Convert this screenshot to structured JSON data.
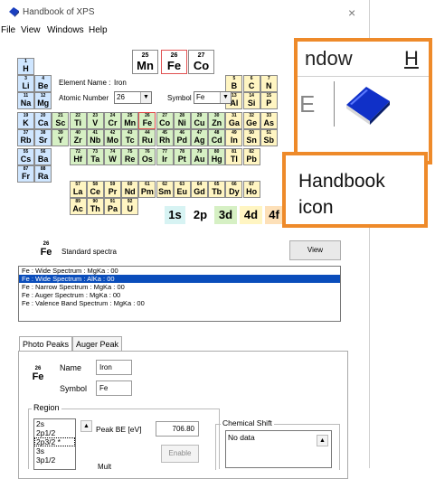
{
  "window": {
    "title": "Handbook of XPS",
    "close_glyph": "×"
  },
  "menu": [
    "File",
    "View",
    "Windows",
    "Help"
  ],
  "element_info": {
    "name_label": "Element Name :",
    "name_value": "Iron",
    "atomic_label": "Atomic Number",
    "atomic_value": "26",
    "symbol_label": "Symbol",
    "symbol_value": "Fe"
  },
  "header_elements": [
    {
      "n": "25",
      "s": "Mn"
    },
    {
      "n": "26",
      "s": "Fe"
    },
    {
      "n": "27",
      "s": "Co"
    }
  ],
  "periodic": {
    "h": {
      "n": "1",
      "s": "H"
    },
    "row2": [
      {
        "n": "3",
        "s": "Li"
      },
      {
        "n": "4",
        "s": "Be"
      }
    ],
    "row2r": [
      {
        "n": "5",
        "s": "B"
      },
      {
        "n": "6",
        "s": "C"
      },
      {
        "n": "7",
        "s": "N"
      }
    ],
    "row3": [
      {
        "n": "11",
        "s": "Na"
      },
      {
        "n": "12",
        "s": "Mg"
      }
    ],
    "row3r": [
      {
        "n": "13",
        "s": "Al"
      },
      {
        "n": "14",
        "s": "Si"
      },
      {
        "n": "15",
        "s": "P"
      }
    ],
    "row4": [
      {
        "n": "19",
        "s": "K"
      },
      {
        "n": "20",
        "s": "Ca"
      },
      {
        "n": "21",
        "s": "Sc"
      },
      {
        "n": "22",
        "s": "Ti"
      },
      {
        "n": "23",
        "s": "V"
      },
      {
        "n": "24",
        "s": "Cr"
      },
      {
        "n": "25",
        "s": "Mn"
      },
      {
        "n": "26",
        "s": "Fe"
      },
      {
        "n": "27",
        "s": "Co"
      },
      {
        "n": "28",
        "s": "Ni"
      },
      {
        "n": "29",
        "s": "Cu"
      },
      {
        "n": "30",
        "s": "Zn"
      },
      {
        "n": "31",
        "s": "Ga"
      },
      {
        "n": "32",
        "s": "Ge"
      },
      {
        "n": "33",
        "s": "As"
      }
    ],
    "row5": [
      {
        "n": "37",
        "s": "Rb"
      },
      {
        "n": "38",
        "s": "Sr"
      },
      {
        "n": "39",
        "s": "Y"
      },
      {
        "n": "40",
        "s": "Zr"
      },
      {
        "n": "41",
        "s": "Nb"
      },
      {
        "n": "42",
        "s": "Mo"
      },
      {
        "n": "43",
        "s": "Tc"
      },
      {
        "n": "44",
        "s": "Ru"
      },
      {
        "n": "45",
        "s": "Rh"
      },
      {
        "n": "46",
        "s": "Pd"
      },
      {
        "n": "47",
        "s": "Ag"
      },
      {
        "n": "48",
        "s": "Cd"
      },
      {
        "n": "49",
        "s": "In"
      },
      {
        "n": "50",
        "s": "Sn"
      },
      {
        "n": "51",
        "s": "Sb"
      }
    ],
    "row6": [
      {
        "n": "55",
        "s": "Cs"
      },
      {
        "n": "56",
        "s": "Ba"
      },
      {
        "n": "",
        "s": ""
      },
      {
        "n": "72",
        "s": "Hf"
      },
      {
        "n": "73",
        "s": "Ta"
      },
      {
        "n": "74",
        "s": "W"
      },
      {
        "n": "75",
        "s": "Re"
      },
      {
        "n": "76",
        "s": "Os"
      },
      {
        "n": "77",
        "s": "Ir"
      },
      {
        "n": "78",
        "s": "Pt"
      },
      {
        "n": "79",
        "s": "Au"
      },
      {
        "n": "80",
        "s": "Hg"
      },
      {
        "n": "81",
        "s": "Tl"
      },
      {
        "n": "82",
        "s": "Pb"
      }
    ],
    "row7": [
      {
        "n": "87",
        "s": "Fr"
      },
      {
        "n": "88",
        "s": "Ra"
      }
    ],
    "lanth": [
      {
        "n": "57",
        "s": "La"
      },
      {
        "n": "58",
        "s": "Ce"
      },
      {
        "n": "59",
        "s": "Pr"
      },
      {
        "n": "60",
        "s": "Nd"
      },
      {
        "n": "61",
        "s": "Pm"
      },
      {
        "n": "62",
        "s": "Sm"
      },
      {
        "n": "63",
        "s": "Eu"
      },
      {
        "n": "64",
        "s": "Gd"
      },
      {
        "n": "65",
        "s": "Tb"
      },
      {
        "n": "66",
        "s": "Dy"
      },
      {
        "n": "67",
        "s": "Ho"
      }
    ],
    "actin": [
      {
        "n": "89",
        "s": "Ac"
      },
      {
        "n": "90",
        "s": "Th"
      },
      {
        "n": "91",
        "s": "Pa"
      },
      {
        "n": "92",
        "s": "U"
      }
    ]
  },
  "orbitals": [
    "1s",
    "2p",
    "3d",
    "4d",
    "4f"
  ],
  "spectra": {
    "element": {
      "n": "26",
      "s": "Fe"
    },
    "label": "Standard spectra",
    "view_label": "View",
    "items": [
      "Fe : Wide Spectrum : MgKa : 00",
      "Fe : Wide Spectrum : AlKa : 00",
      "Fe : Narrow Spectrum : MgKa : 00",
      "Fe : Auger Spectrum : MgKa : 00",
      "Fe : Valence Band Spectrum : MgKa : 00"
    ],
    "selected_index": 1
  },
  "tabs": [
    "Photo Peaks",
    "Auger Peak"
  ],
  "photo_peaks": {
    "element": {
      "n": "26",
      "s": "Fe"
    },
    "name_label": "Name",
    "name_value": "Iron",
    "symbol_label": "Symbol",
    "symbol_value": "Fe",
    "region_label": "Region",
    "regions": [
      "2s",
      "2p1/2",
      "2p3/2 *",
      "3s",
      "3p1/2"
    ],
    "selected_region": 2,
    "peak_be_label": "Peak BE [eV]",
    "peak_be_value": "706.80",
    "enable_label": "Enable",
    "chem_shift_label": "Chemical Shift",
    "chem_shift_value": "No data",
    "partial_label": "Mult"
  },
  "zoom_overlay": {
    "menu_fragment": "ndow",
    "menu_fragment2": "H",
    "left_glyph": "E"
  },
  "callout": {
    "line1": "Handbook",
    "line2": "icon"
  },
  "colors": {
    "accent_orange": "#ee8a2a",
    "selection_blue": "#0a4dbb",
    "book_blue": "#1030c8"
  },
  "icons": {
    "app": "handbook-book-icon",
    "book": "handbook-book-icon"
  }
}
